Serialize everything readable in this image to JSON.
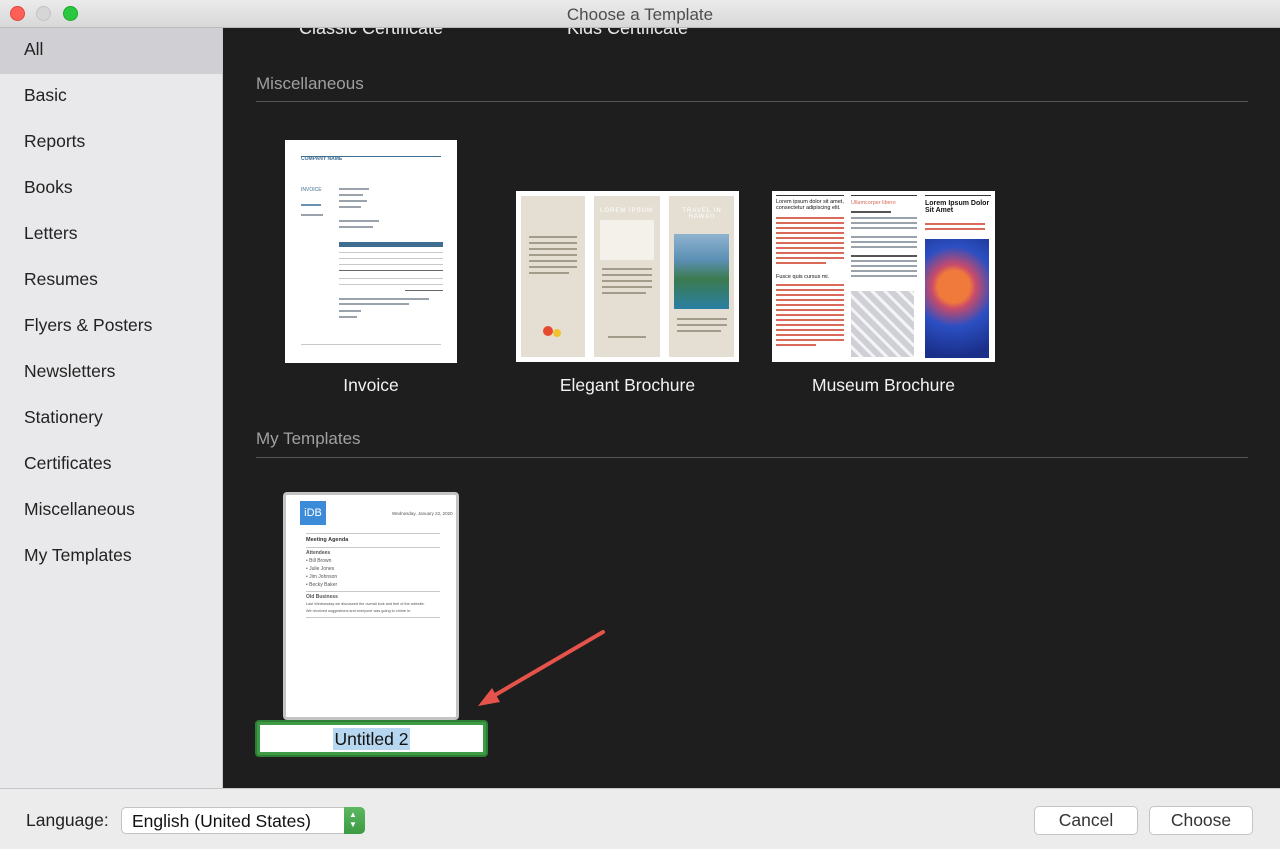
{
  "window": {
    "title": "Choose a Template"
  },
  "sidebar": {
    "items": [
      {
        "label": "All",
        "selected": true
      },
      {
        "label": "Basic"
      },
      {
        "label": "Reports"
      },
      {
        "label": "Books"
      },
      {
        "label": "Letters"
      },
      {
        "label": "Resumes"
      },
      {
        "label": "Flyers & Posters"
      },
      {
        "label": "Newsletters"
      },
      {
        "label": "Stationery"
      },
      {
        "label": "Certificates"
      },
      {
        "label": "Miscellaneous"
      },
      {
        "label": "My Templates"
      }
    ]
  },
  "main": {
    "cut_labels": [
      "Classic Certificate",
      "Kids Certificate"
    ],
    "sections": {
      "misc": {
        "title": "Miscellaneous",
        "templates": [
          {
            "label": "Invoice"
          },
          {
            "label": "Elegant Brochure"
          },
          {
            "label": "Museum Brochure"
          }
        ]
      },
      "mine": {
        "title": "My Templates",
        "templates": [
          {
            "label": "Untitled 2"
          }
        ]
      }
    },
    "thumb_text": {
      "company_name": "COMPANY NAME",
      "invoice": "INVOICE",
      "lorem_ipsum": "LOREM IPSUM",
      "travel_hawaii": "TRAVEL IN HAWAII",
      "museum_head": "Lorem ipsum dolor sit amet, consectetur adipiscing elit.",
      "museum_sub": "Fusce quis cursus mi.",
      "museum_head2": "Lorem Ipsum Dolor Sit Amet",
      "ullamcorper": "Ullamcorper libero",
      "idb": "iDB",
      "idb_date": "Wednesday, January 22, 2020",
      "agenda": "Meeting Agenda",
      "attendees": "Attendees",
      "names": [
        "• Bill Brown",
        "• Julie Jones",
        "• Jim Johnson",
        "• Becky Baker"
      ],
      "old_business": "Old Business",
      "ob_line1": "Last Wednesday we discussed the overall look and feel of the website.",
      "ob_line2": "We received suggestions and everyone was going to chime in."
    }
  },
  "footer": {
    "language_label": "Language:",
    "language_value": "English (United States)",
    "cancel": "Cancel",
    "choose": "Choose"
  },
  "colors": {
    "accent_green": "#3f9a45",
    "annotation_arrow": "#e5534b",
    "selection_highlight": "#b7d7f0"
  },
  "icons": [
    "close-window",
    "minimize-window",
    "zoom-window",
    "stepper-arrows",
    "annotation-arrow"
  ]
}
